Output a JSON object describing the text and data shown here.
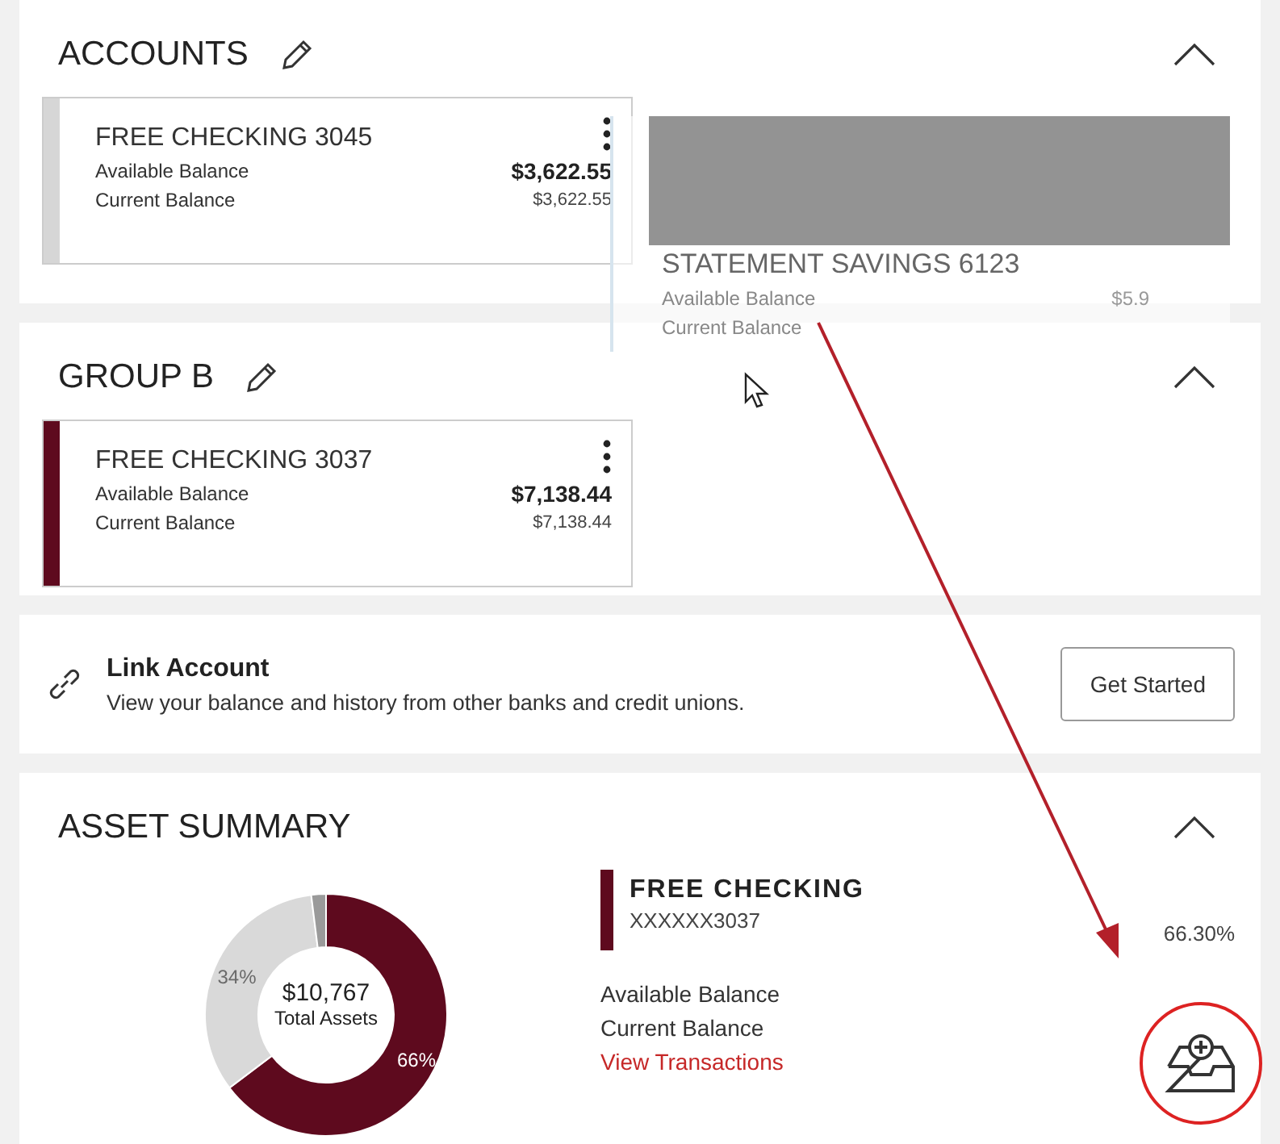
{
  "accounts": {
    "title": "ACCOUNTS",
    "expanded": true,
    "cards": [
      {
        "name": "FREE CHECKING 3045",
        "available_label": "Available Balance",
        "available": "$3,622.55",
        "current_label": "Current Balance",
        "current": "$3,622.55",
        "color": "#d6d6d6"
      }
    ]
  },
  "drag_card": {
    "name": "STATEMENT SAVINGS 6123",
    "available_label": "Available Balance",
    "available": "$5.9",
    "current_label": "Current Balance"
  },
  "group": {
    "title": "GROUP B",
    "expanded": true,
    "cards": [
      {
        "name": "FREE CHECKING 3037",
        "available_label": "Available Balance",
        "available": "$7,138.44",
        "current_label": "Current Balance",
        "current": "$7,138.44",
        "color": "#5e0a1e"
      }
    ]
  },
  "link": {
    "title": "Link Account",
    "text": "View your balance and history from other banks and credit unions.",
    "button": "Get Started"
  },
  "asset_summary": {
    "title": "ASSET SUMMARY",
    "expanded": true,
    "total": "$10,767",
    "total_label": "Total Assets",
    "chart_data": {
      "type": "donut",
      "values": [
        66,
        34,
        2
      ],
      "value_labels": [
        "66%",
        "34%",
        null
      ],
      "colors": [
        "#5e0a1e",
        "#d9d9d9",
        "#9a9a9a"
      ]
    },
    "account": {
      "name": "FREE CHECKING",
      "number": "XXXXXX3037",
      "percent": "66.30%",
      "available_label": "Available Balance",
      "current_label": "Current Balance",
      "link": "View Transactions",
      "color": "#5e0a1e"
    }
  }
}
